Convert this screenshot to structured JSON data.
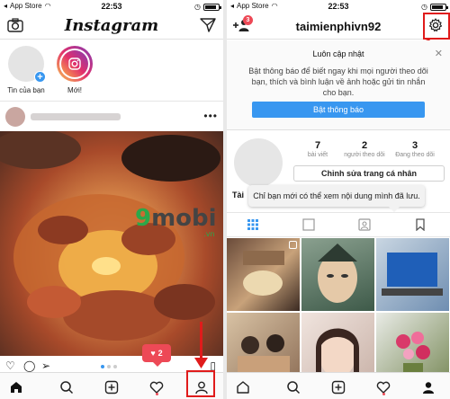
{
  "left": {
    "status": {
      "carrier": "App Store",
      "time": "22:53"
    },
    "header": {
      "logo": "Instagram"
    },
    "stories": [
      {
        "label": "Tin của bạn"
      },
      {
        "label": "Mới!"
      }
    ],
    "watermark": {
      "nine": "9",
      "brand": "mobi",
      "tld": ".vn"
    },
    "notification": {
      "count": "2"
    },
    "post": {
      "more": "•••"
    }
  },
  "right": {
    "status": {
      "carrier": "App Store",
      "time": "22:53"
    },
    "header": {
      "username": "taimienphivn92",
      "badge": "3"
    },
    "banner": {
      "title": "Luôn cập nhật",
      "text": "Bật thông báo để biết ngay khi mọi người theo dõi bạn, thích và bình luận về ảnh hoặc gửi tin nhắn cho bạn.",
      "button": "Bật thông báo",
      "close": "✕"
    },
    "stats": [
      {
        "num": "7",
        "label": "bài viết"
      },
      {
        "num": "2",
        "label": "người theo dõi"
      },
      {
        "num": "3",
        "label": "Đang theo dõi"
      }
    ],
    "edit_button": "Chỉnh sửa trang cá nhân",
    "name_partial": "Tài",
    "tooltip": "Chỉ bạn mới có thể xem nội dung mình đã lưu."
  },
  "colors": {
    "accent": "#3897f0",
    "like_red": "#ed4956",
    "annotation_red": "#e01b1b"
  }
}
